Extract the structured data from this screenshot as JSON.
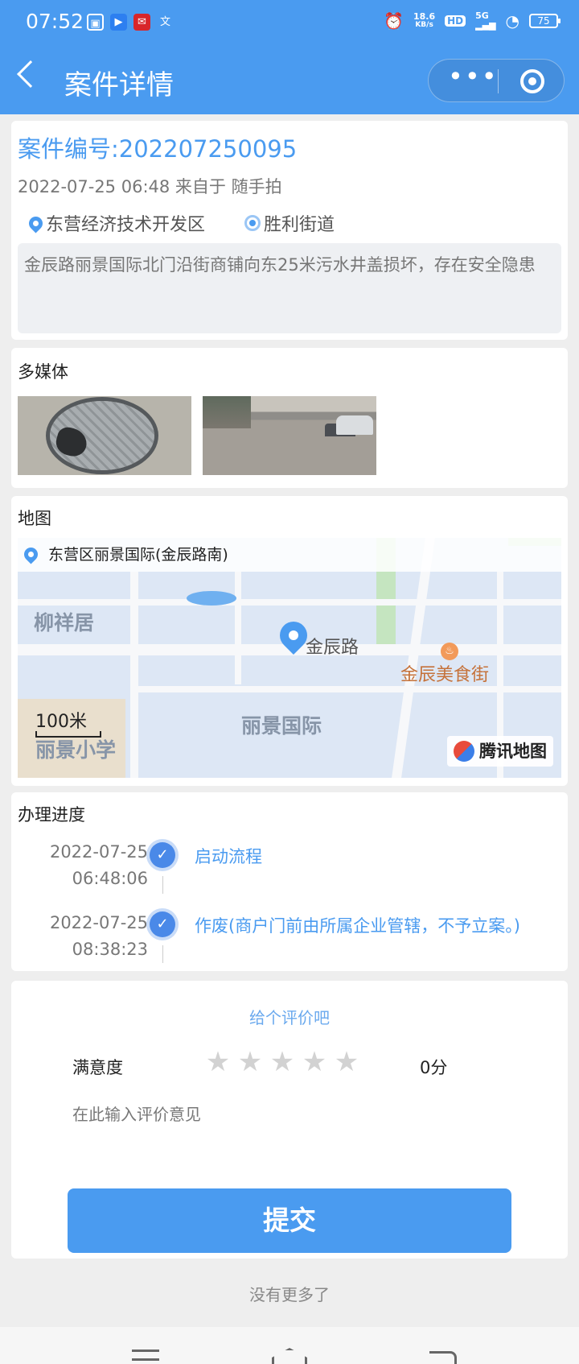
{
  "status_bar": {
    "time": "07:52",
    "net_speed": "18.6",
    "net_unit": "KB/s",
    "hd": "HD",
    "signal": "5G",
    "battery": "75"
  },
  "header": {
    "title": "案件详情"
  },
  "case": {
    "number": "案件编号:202207250095",
    "meta": "2022-07-25 06:48 来自于 随手拍",
    "district": "东营经济技术开发区",
    "street": "胜利街道",
    "description": "金辰路丽景国际北门沿街商铺向东25米污水井盖损坏，存在安全隐患"
  },
  "media": {
    "title": "多媒体"
  },
  "map": {
    "title": "地图",
    "address": "东营区丽景国际(金辰路南)",
    "labels": {
      "liuxiangju": "柳祥居",
      "jinchenlu": "金辰路",
      "meishijie": "金辰美食街",
      "lijingguoji": "丽景国际",
      "lijingxiaoxue": "丽景小学"
    },
    "scale": "100米",
    "provider": "腾讯地图"
  },
  "progress": {
    "title": "办理进度",
    "steps": [
      {
        "date": "2022-07-25",
        "time": "06:48:06",
        "text": "启动流程"
      },
      {
        "date": "2022-07-25",
        "time": "08:38:23",
        "text": "作废(商户门前由所属企业管辖，不予立案。)"
      }
    ]
  },
  "rating": {
    "title": "给个评价吧",
    "label": "满意度",
    "stars": 0,
    "score": "0分",
    "placeholder": "在此输入评价意见",
    "submit": "提交"
  },
  "footer": {
    "no_more": "没有更多了"
  }
}
